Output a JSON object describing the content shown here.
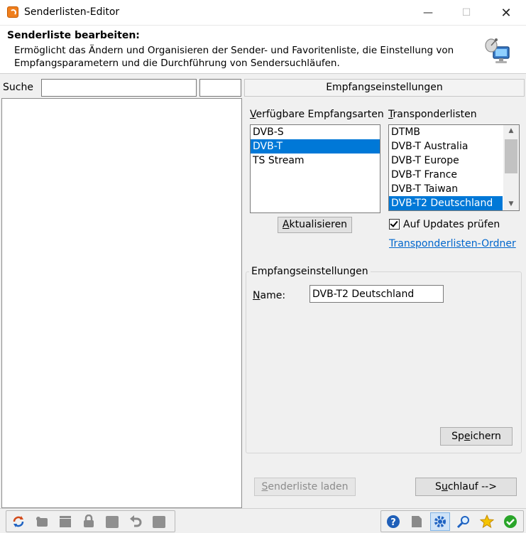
{
  "window": {
    "title": "Senderlisten-Editor",
    "min_glyph": "—",
    "max_glyph": "☐",
    "close_glyph": "✕"
  },
  "header": {
    "title": "Senderliste bearbeiten:",
    "description": "Ermöglicht das Ändern und Organisieren der Sender- und Favoritenliste, die Einstellung von Empfangsparametern und die Durchführung von Sendersuchläufen."
  },
  "search": {
    "label": "Suche",
    "value": ""
  },
  "panel": {
    "header": "Empfangseinstellungen",
    "types_label": "Verfügbare Empfangsarten",
    "types": [
      {
        "label": "DVB-S",
        "selected": false
      },
      {
        "label": "DVB-T",
        "selected": true
      },
      {
        "label": "TS Stream",
        "selected": false
      }
    ],
    "transponder_label": "Transponderlisten",
    "transponders": [
      {
        "label": "DTMB",
        "selected": false
      },
      {
        "label": "DVB-T Australia",
        "selected": false
      },
      {
        "label": "DVB-T Europe",
        "selected": false
      },
      {
        "label": "DVB-T France",
        "selected": false
      },
      {
        "label": "DVB-T Taiwan",
        "selected": false
      },
      {
        "label": "DVB-T2 Deutschland",
        "selected": true
      }
    ],
    "refresh_button": "Aktualisieren",
    "check_updates": {
      "label": "Auf Updates prüfen",
      "checked": true
    },
    "folder_link": "Transponderlisten-Ordner",
    "group": {
      "title": "Empfangseinstellungen",
      "name_label": "Name:",
      "name_value": "DVB-T2 Deutschland",
      "save_button": "Speichern"
    },
    "load_button": "Senderliste laden",
    "scan_button": "Suchlauf -->"
  },
  "toolbar": {
    "left": [
      "refresh-icon",
      "tv-icon",
      "clapper-icon",
      "lock-icon",
      "square-icon",
      "undo-icon",
      "square-icon"
    ],
    "right": [
      "help-icon",
      "note-icon",
      "gear-icon",
      "magnifier-icon",
      "star-icon",
      "ok-icon"
    ]
  },
  "colors": {
    "selection": "#0078d7",
    "link": "#0066cc",
    "accent_orange": "#f07f1d",
    "ok_green": "#2aa52a",
    "star_yellow": "#f5c400"
  }
}
